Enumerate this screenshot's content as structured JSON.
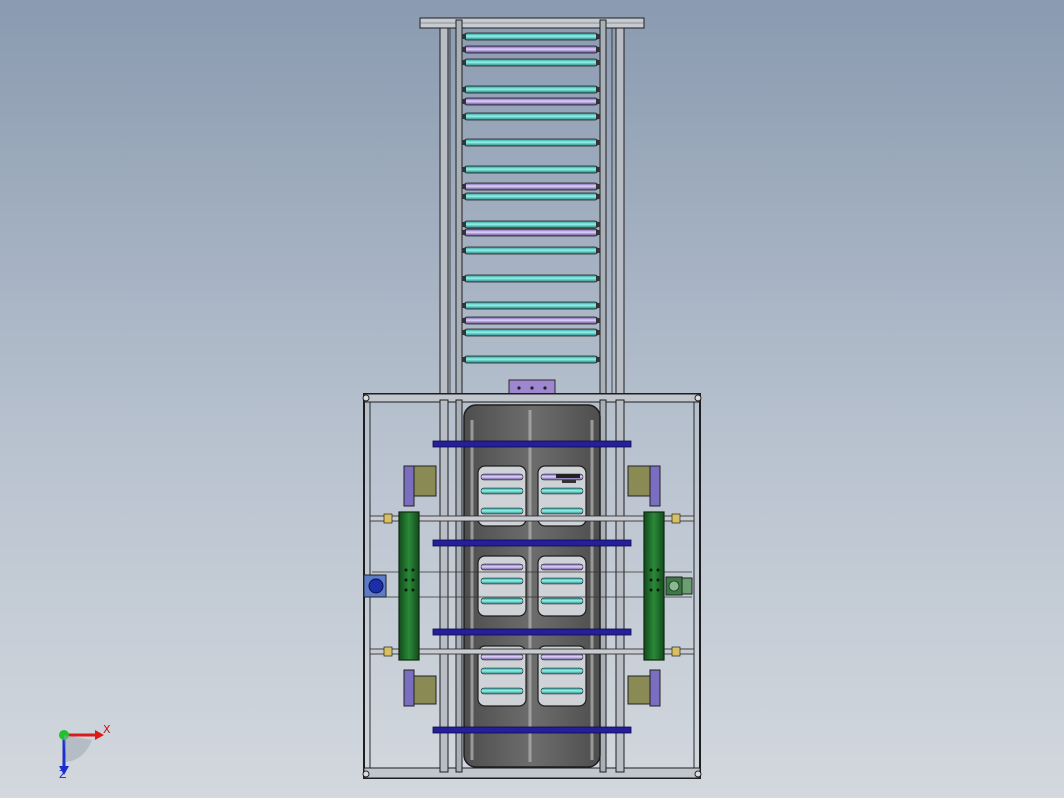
{
  "viewport": {
    "background_top": "#8a9ab0",
    "background_bottom": "#d3d8de"
  },
  "triad": {
    "x_label": "X",
    "z_label": "Z",
    "x_color": "#d81b1b",
    "y_color": "#22c02a",
    "z_color": "#1a2fd0"
  },
  "colors": {
    "frame_stroke": "#1e1e1e",
    "frame_fill": "#b9bec6",
    "roller_cyan": "#58e0d8",
    "roller_lilac": "#b8a0e0",
    "crossbar": "#25209a",
    "tray": "#5a5a5a",
    "green_carriage": "#1f6b2a",
    "pad_olive": "#8a8a55",
    "block_lilac": "#9e86d0",
    "motor_blue": "#2540b8"
  }
}
